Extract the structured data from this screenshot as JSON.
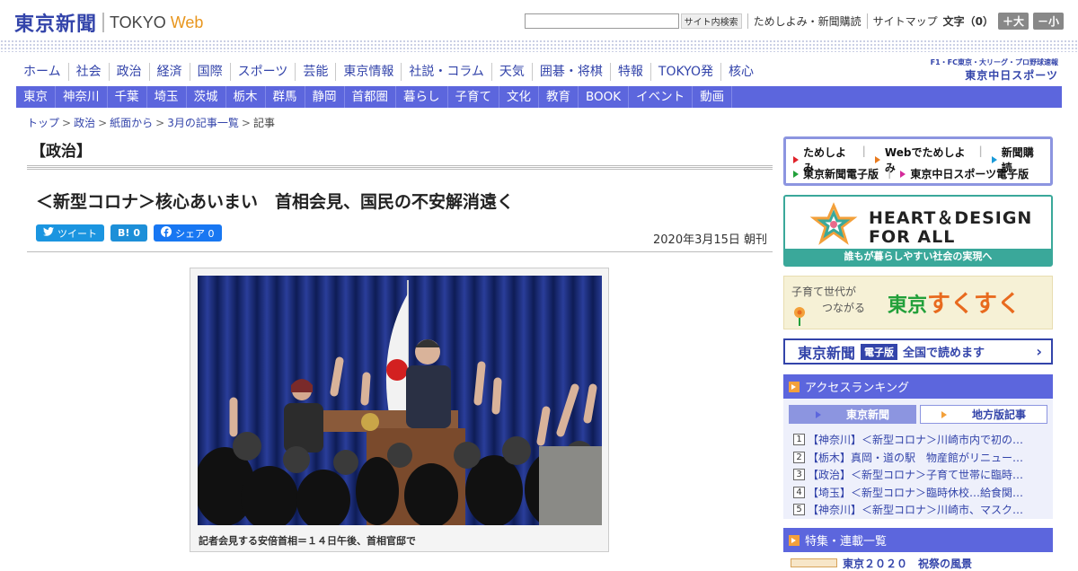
{
  "header": {
    "logo_jp": "東京新聞",
    "logo_en_prefix": "TOKYO ",
    "logo_en_web": "Web",
    "search_button": "サイト内検索",
    "links": [
      "ためしよみ・新聞購読",
      "サイトマップ"
    ],
    "font_size_label": "文字（0）",
    "font_larger": "＋大",
    "font_smaller": "－小"
  },
  "nav_primary": [
    "ホーム",
    "社会",
    "政治",
    "経済",
    "国際",
    "スポーツ",
    "芸能",
    "東京情報",
    "社説・コラム",
    "天気",
    "囲碁・将棋",
    "特報",
    "TOKYO発",
    "核心"
  ],
  "chunichi_sports": {
    "small": "F1・FC東京・大リーグ・プロ野球速報",
    "big": "東京中日スポーツ"
  },
  "nav_secondary": [
    "東京",
    "神奈川",
    "千葉",
    "埼玉",
    "茨城",
    "栃木",
    "群馬",
    "静岡",
    "首都圏",
    "暮らし",
    "子育て",
    "文化",
    "教育",
    "BOOK",
    "イベント",
    "動画"
  ],
  "breadcrumb": [
    "トップ",
    "政治",
    "紙面から",
    "3月の記事一覧"
  ],
  "breadcrumb_current": "記事",
  "article": {
    "section": "【政治】",
    "headline": "＜新型コロナ＞核心あいまい　首相会見、国民の不安解消遠く",
    "tweet": "ツイート",
    "hatena_icon": "B!",
    "hatena_count": "0",
    "fb_share": "シェア 0",
    "date": "2020年3月15日 朝刊",
    "caption": "記者会見する安倍首相＝１４日午後、首相官邸で"
  },
  "side_links": {
    "row1": [
      "ためしよみ",
      "Webでためしよみ",
      "新聞購読"
    ],
    "row2": [
      "東京新聞電子版",
      "東京中日スポーツ電子版"
    ]
  },
  "heart_design": {
    "line1": "HEART＆DESIGN",
    "line2": "FOR ALL",
    "sub": "誰もが暮らしやすい社会の実現へ"
  },
  "sukusuku": {
    "line1": "子育て世代が",
    "line2": "つながる",
    "tokyo": "東京",
    "big": "すくすく"
  },
  "denshi": {
    "logo": "東京新聞",
    "tag": "電子版",
    "text": "全国で読めます"
  },
  "ranking": {
    "title": "アクセスランキング",
    "tab_active": "東京新聞",
    "tab_inactive": "地方版記事",
    "items": [
      "【神奈川】＜新型コロナ＞川崎市内で初の…",
      "【栃木】真岡・道の駅　物産館がリニュー…",
      "【政治】＜新型コロナ＞子育て世帯に臨時…",
      "【埼玉】＜新型コロナ＞臨時休校…給食関…",
      "【神奈川】＜新型コロナ＞川崎市、マスク…"
    ]
  },
  "features": {
    "title": "特集・連載一覧",
    "peek_text": "東京２０２０　祝祭の風景"
  },
  "colors": {
    "brand_blue": "#3344aa",
    "nav_blue": "#5c66dd",
    "accent_orange": "#e8961e",
    "teal": "#3aa89a"
  }
}
